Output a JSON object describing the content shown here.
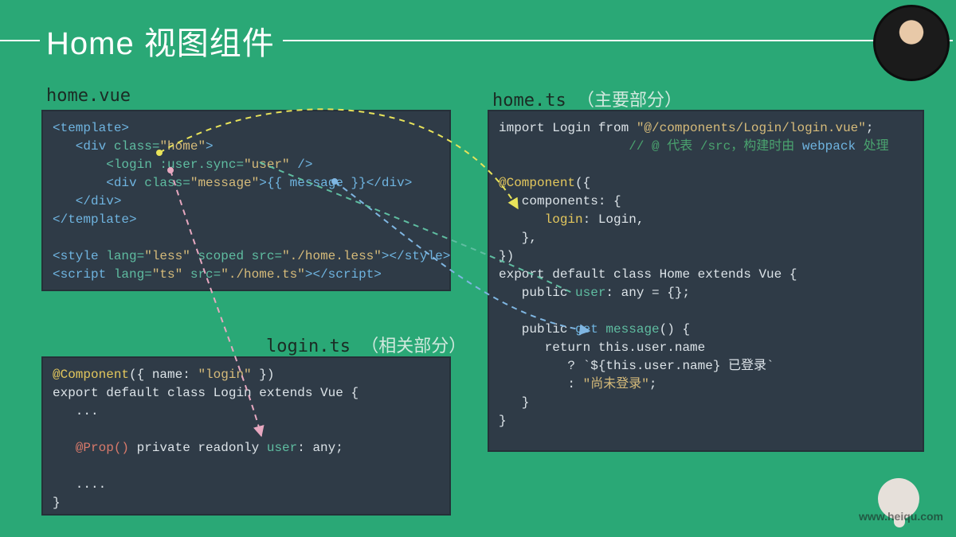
{
  "title": "Home 视图组件",
  "labels": {
    "homeVue": "home.vue",
    "loginTs": "login.ts",
    "loginTsNote": "（相关部分）",
    "homeTs": "home.ts",
    "homeTsNote": "（主要部分）"
  },
  "code": {
    "homeVue": {
      "l1a": "<template>",
      "l2a": "   <div",
      "l2b": " class=",
      "l2c": "\"home\"",
      "l2d": ">",
      "l3a": "       <login",
      "l3b": " :user.sync=",
      "l3c": "\"user\"",
      "l3d": " />",
      "l4a": "       <div",
      "l4b": " class=",
      "l4c": "\"message\"",
      "l4d": ">",
      "l4e": "{{ message }}",
      "l4f": "</div>",
      "l5a": "   </div>",
      "l6a": "</template>",
      "l7": "",
      "l8a": "<style",
      "l8b": " lang=",
      "l8c": "\"less\"",
      "l8d": " scoped",
      "l8e": " src=",
      "l8f": "\"./home.less\"",
      "l8g": "></style>",
      "l9a": "<script",
      "l9b": " lang=",
      "l9c": "\"ts\"",
      "l9d": " src=",
      "l9e": "\"./home.ts\"",
      "l9f": "></script>"
    },
    "loginTs": {
      "l1a": "@Component",
      "l1b": "({ name: ",
      "l1c": "\"login\"",
      "l1d": " })",
      "l2a": "export default class Login extends Vue {",
      "l3a": "   ...",
      "l4": "",
      "l5a": "   @Prop()",
      "l5b": " private readonly ",
      "l5c": "user",
      "l5d": ": any;",
      "l6": "",
      "l7a": "   ....",
      "l8a": "}"
    },
    "homeTs": {
      "l1a": "import Login from ",
      "l1b": "\"@/components/Login/login.vue\"",
      "l1c": ";",
      "l2a": "                 // @ 代表 /src，构建时由 ",
      "l2b": "webpack",
      "l2c": " 处理",
      "l3": "",
      "l4a": "@Component",
      "l4b": "({",
      "l5a": "   components: {",
      "l6a": "      login",
      "l6b": ": Login,",
      "l7a": "   },",
      "l8a": "})",
      "l9a": "export default class Home extends Vue {",
      "l10a": "   public ",
      "l10b": "user",
      "l10c": ": any = {};",
      "l11": "",
      "l12a": "   public ",
      "l12b": "get",
      "l12c": " message",
      "l12d": "() {",
      "l13a": "      return this.user.name",
      "l14a": "         ? `${this.user.name} 已登录`",
      "l15a": "         : ",
      "l15b": "\"尚未登录\"",
      "l15c": ";",
      "l16a": "   }",
      "l17a": "}"
    }
  },
  "watermark": {
    "site": "www.heiqu.com"
  }
}
